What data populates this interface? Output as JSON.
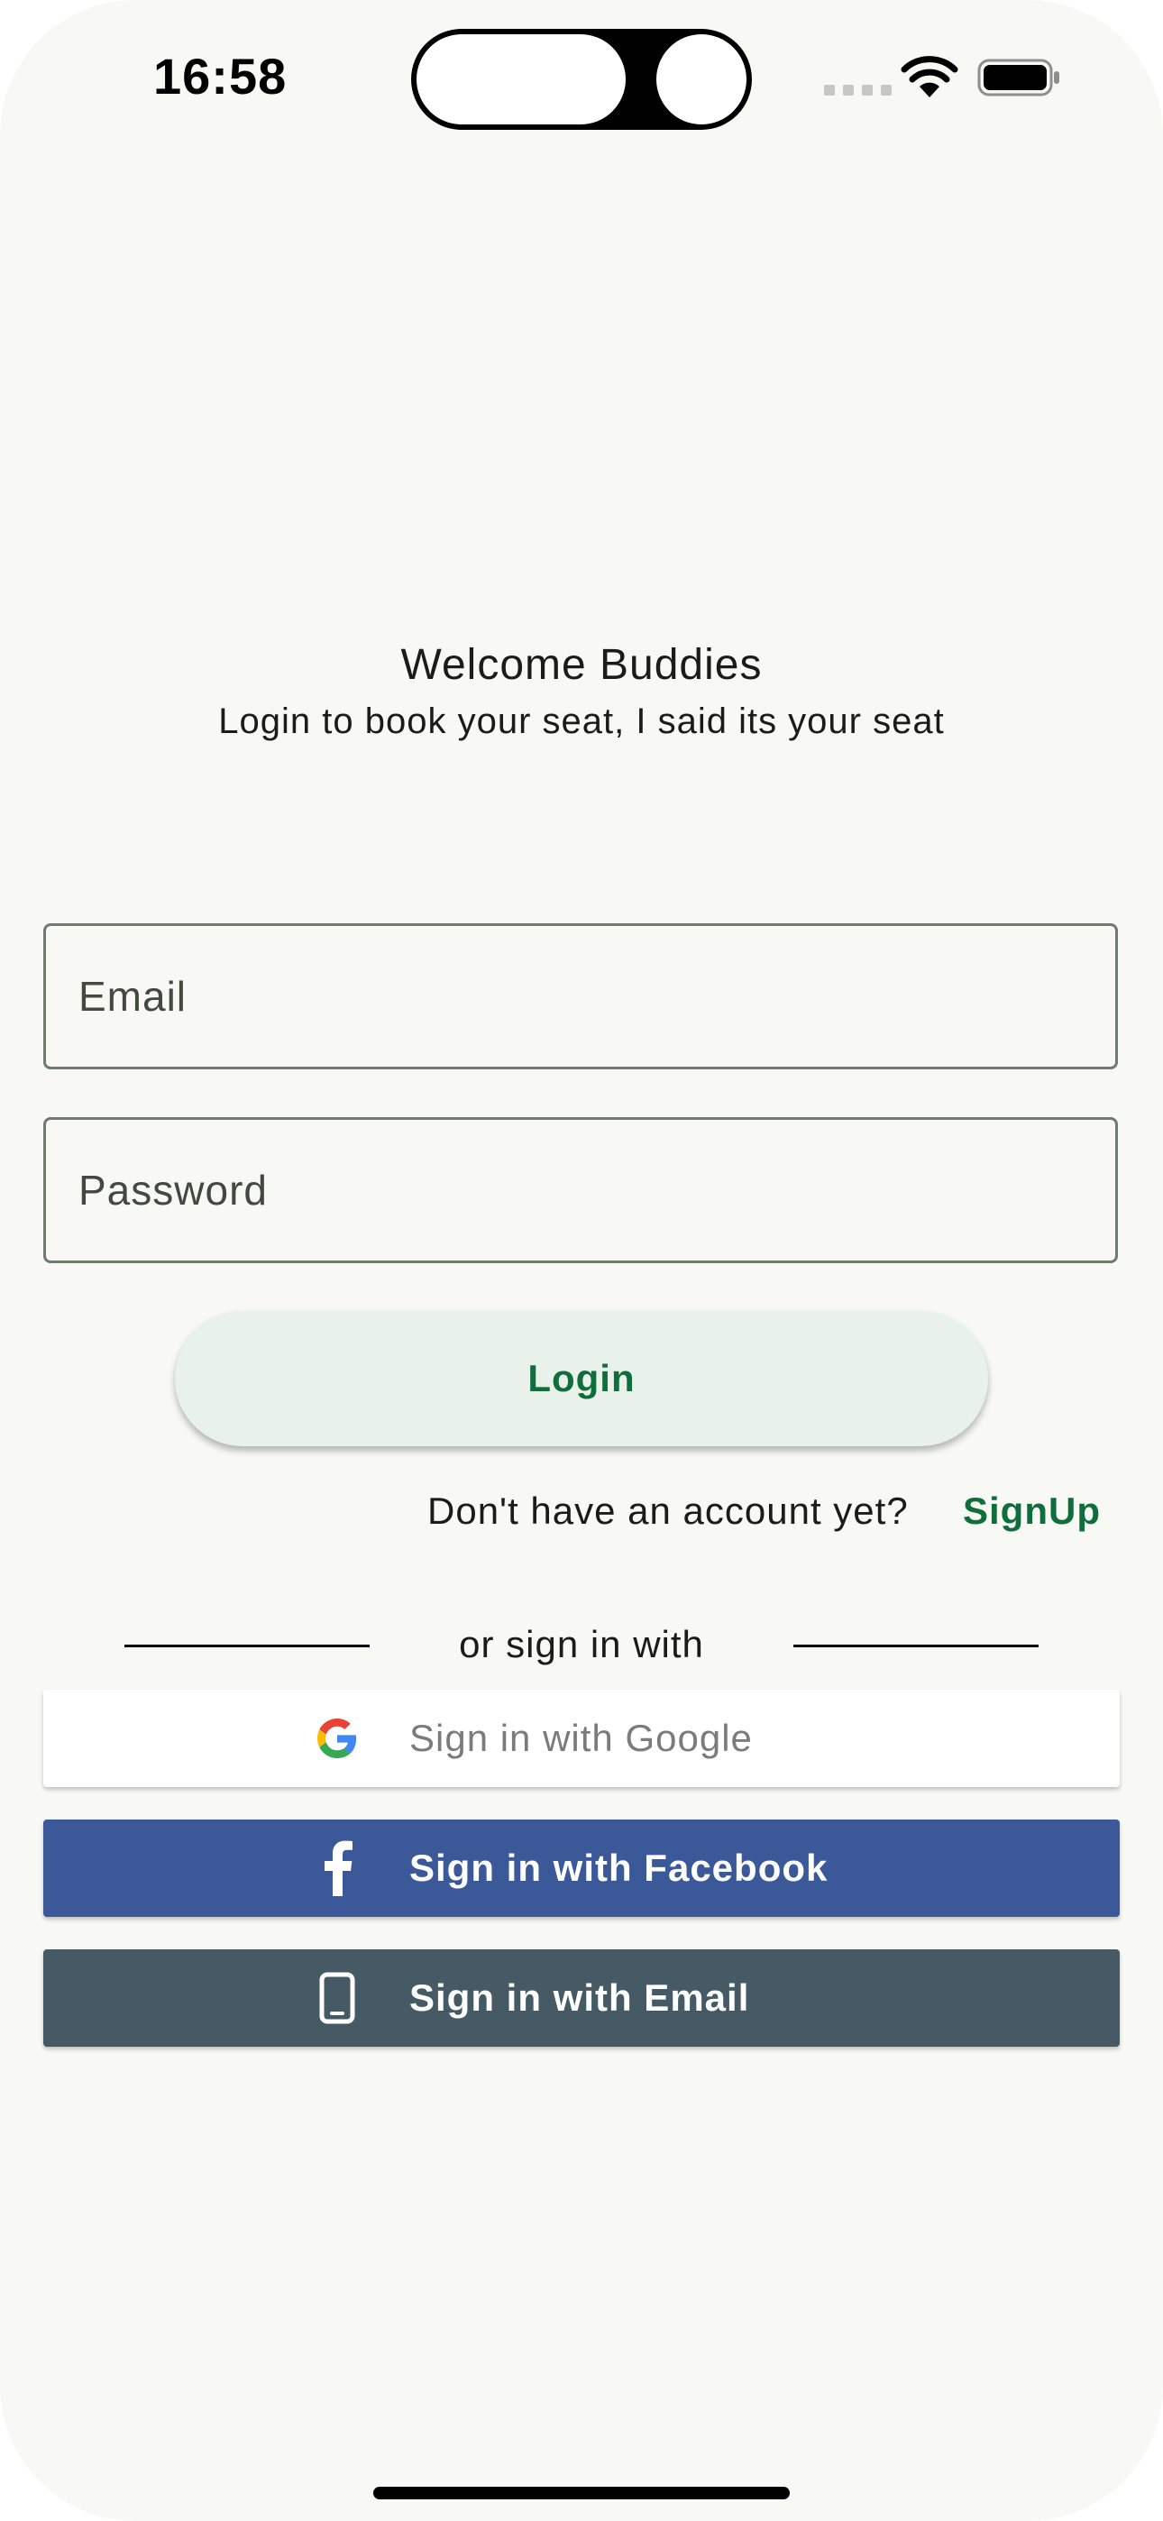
{
  "status_bar": {
    "time": "16:58"
  },
  "header": {
    "title": "Welcome Buddies",
    "subtitle": "Login to book your seat, I said its your seat"
  },
  "form": {
    "email_placeholder": "Email",
    "password_placeholder": "Password",
    "login_label": "Login"
  },
  "signup": {
    "prompt": "Don't have an account yet?",
    "link_label": "SignUp"
  },
  "divider": {
    "label": "or sign in with"
  },
  "social": {
    "google_label": "Sign in with Google",
    "facebook_label": "Sign in with Facebook",
    "email_label": "Sign in with Email"
  },
  "colors": {
    "background": "#f8f9f4",
    "accent": "#106d3c",
    "login_button_bg": "#e9f1eb",
    "facebook_bg": "#3b5998",
    "email_bg": "#465a65",
    "google_bg": "#ffffff"
  },
  "icons": {
    "google": "google-g-icon",
    "facebook": "facebook-f-icon",
    "email": "mobile-phone-icon",
    "wifi": "wifi-icon",
    "battery": "battery-icon"
  }
}
